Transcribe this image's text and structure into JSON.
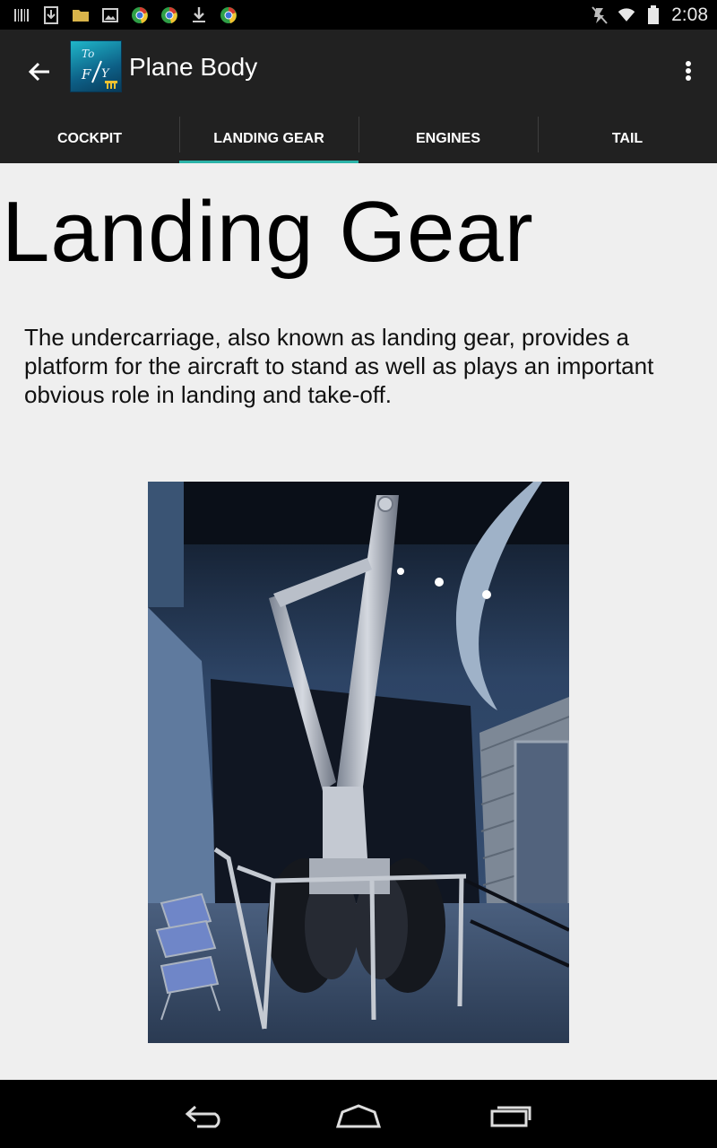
{
  "status_bar": {
    "time": "2:08",
    "left_icons": [
      "barcode-icon",
      "download-box-icon",
      "folder-icon",
      "image-icon",
      "chrome-like-icon",
      "chrome-like-icon",
      "download-icon",
      "chrome-like-icon"
    ],
    "right_icons": [
      "mute-icon",
      "wifi-icon",
      "battery-icon"
    ]
  },
  "action_bar": {
    "title": "Plane Body",
    "app_icon_text": "To F/Y"
  },
  "tabs": [
    {
      "label": "COCKPIT",
      "active": false
    },
    {
      "label": "LANDING GEAR",
      "active": true
    },
    {
      "label": "ENGINES",
      "active": false
    },
    {
      "label": "TAIL",
      "active": false
    }
  ],
  "main": {
    "heading": "Landing Gear",
    "description": "The undercarriage, also known as landing gear, provides a platform for the aircraft to stand as well as plays an important obvious role in landing and take-off."
  },
  "colors": {
    "action_bar_bg": "#212121",
    "tab_indicator": "#2bb3a8",
    "content_bg": "#efefef"
  }
}
